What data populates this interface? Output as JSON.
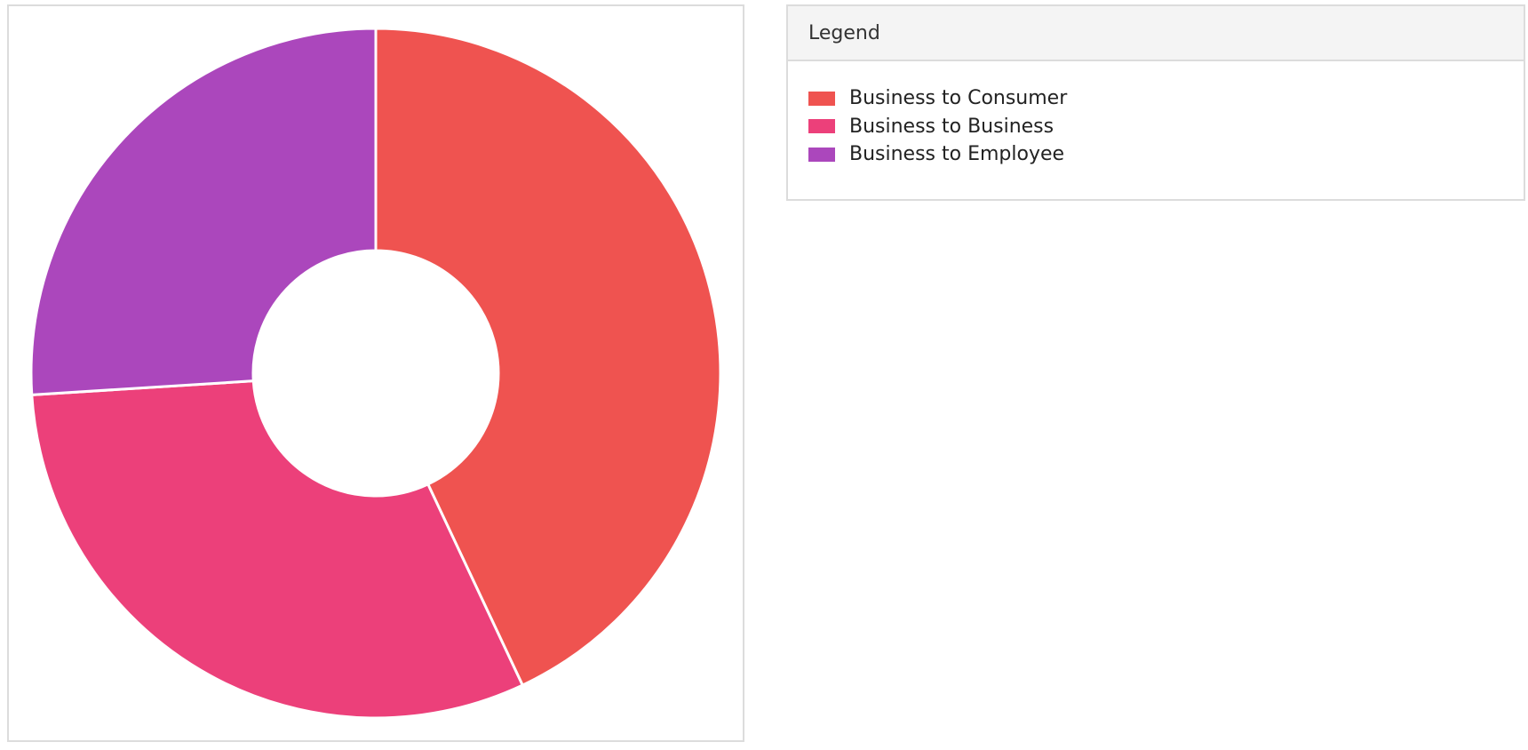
{
  "legend": {
    "title": "Legend"
  },
  "chart_data": {
    "type": "pie",
    "donut": true,
    "title": "",
    "legend_position": "right",
    "slices": [
      {
        "label": "Business to Consumer",
        "value": 43,
        "color": "#ef5350"
      },
      {
        "label": "Business to Business",
        "value": 31,
        "color": "#ec407a"
      },
      {
        "label": "Business to Employee",
        "value": 26,
        "color": "#ab47bc"
      }
    ]
  }
}
